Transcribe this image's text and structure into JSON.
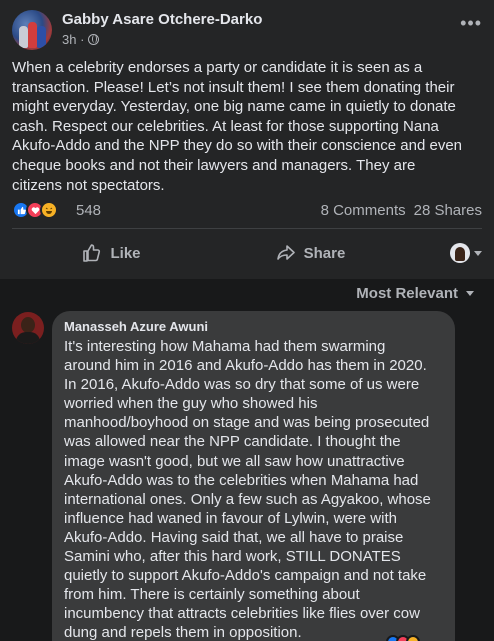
{
  "post": {
    "author": "Gabby Asare Otchere-Darko",
    "time": "3h ·",
    "menu_icon": "more-icon",
    "text": "When a celebrity endorses a party or candidate it is seen as a\ntransaction. Please! Let’s not insult them! I see them  donating their\nmight everyday. Yesterday, one big name came in quietly to donate\ncash. Respect our celebrities. At least for those supporting Nana\nAkufo-Addo and the NPP they do so with their conscience and even\ncheque books and not their lawyers and managers. They are\ncitizens not spectators.",
    "reaction_count": "548",
    "comments": "8 Comments",
    "shares": "28 Shares",
    "reaction_icons": [
      "like-icon",
      "love-icon",
      "haha-icon"
    ]
  },
  "actions": {
    "like_label": "Like",
    "share_label": "Share"
  },
  "comments_sort": "Most Relevant",
  "comment": {
    "author": "Manasseh Azure Awuni",
    "text": "It's interesting how Mahama had them swarming\naround him in 2016 and Akufo-Addo has them in 2020.\nIn 2016, Akufo-Addo was so dry that some of us were\nworried when the guy who showed his\nmanhood/boyhood on stage and was being prosecuted\nwas allowed near the NPP candidate. I thought the\nimage wasn't good, but we all saw how unattractive\nAkufo-Addo was to the celebrities when Mahama had\ninternational ones. Only a few such as Agyakoo, whose\ninfluence had waned in favour of Lylwin, were with\nAkufo-Addo. Having said that, we all have to praise\nSamini who, after this hard work, STILL DONATES\nquietly to support Akufo-Addo's campaign and not take\nfrom him. There is certainly something about\nincumbency that attracts celebrities like flies over cow\ndung and repels them in opposition."
  },
  "colors": {
    "background": "#18191a",
    "card": "#242526",
    "bubble": "#3a3b3c",
    "text": "#e4e6eb",
    "secondary": "#b0b3b8",
    "like_blue": "#1877f2",
    "love_red": "#f33e58",
    "haha_yellow": "#f7b125"
  }
}
